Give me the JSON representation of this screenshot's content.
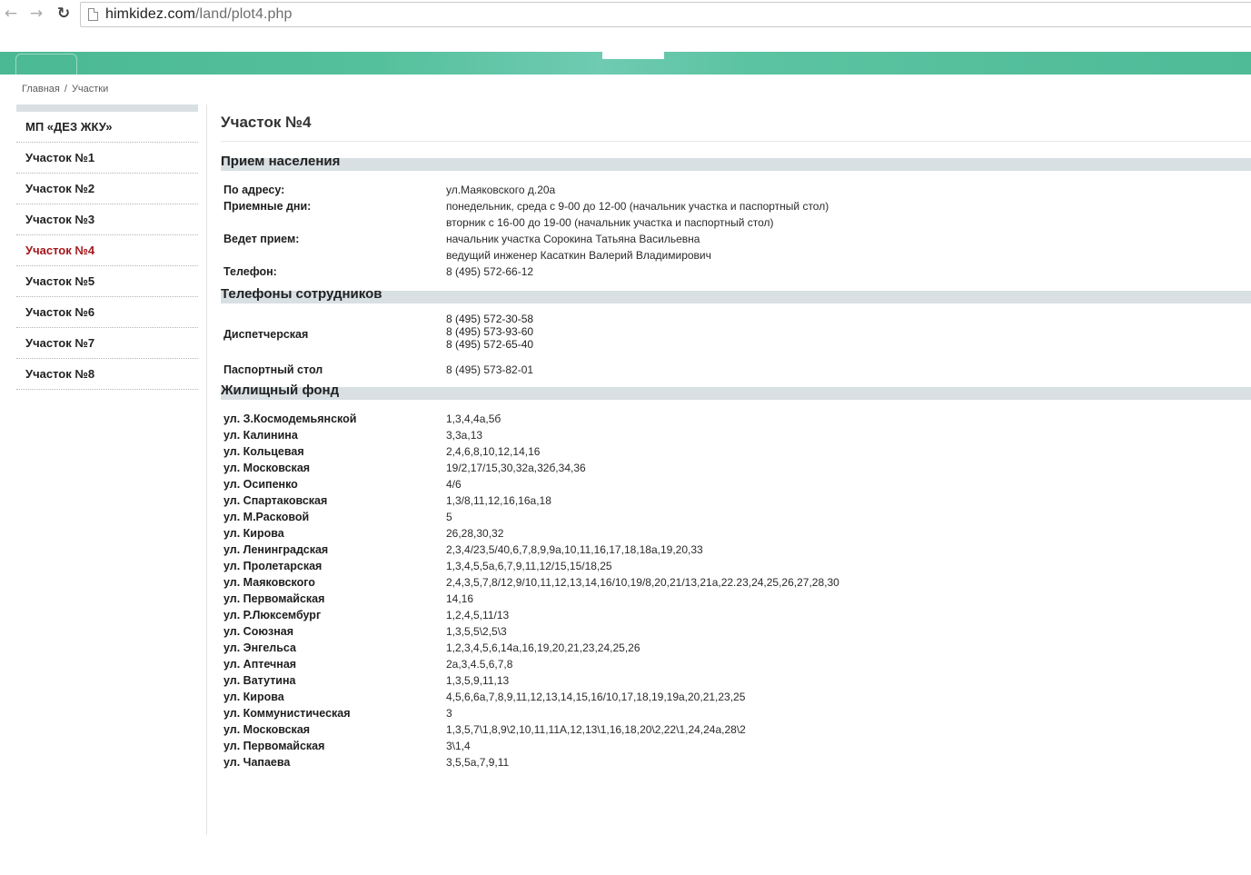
{
  "browser": {
    "url_host": "himkidez.com",
    "url_path": "/land/plot4.php"
  },
  "breadcrumb": {
    "home": "Главная",
    "sep": "/",
    "current": "Участки"
  },
  "sidebar": {
    "items": [
      {
        "label": "МП «ДЕЗ ЖКУ»"
      },
      {
        "label": "Участок №1"
      },
      {
        "label": "Участок №2"
      },
      {
        "label": "Участок №3"
      },
      {
        "label": "Участок №4",
        "active": true
      },
      {
        "label": "Участок №5"
      },
      {
        "label": "Участок №6"
      },
      {
        "label": "Участок №7"
      },
      {
        "label": "Участок №8"
      }
    ],
    "active_color": "#a3171c"
  },
  "main": {
    "title": "Участок №4",
    "reception": {
      "heading": "Прием населения",
      "address_label": "По адресу:",
      "address_value": "ул.Маяковского д.20а",
      "days_label": "Приемные дни:",
      "days_line1": "понедельник, среда с 9-00 до 12-00 (начальник участка и паспортный стол)",
      "days_line2": "вторник с 16-00 до 19-00 (начальник участка и паспортный стол)",
      "host_label": "Ведет прием:",
      "host_line1": "начальник участка Сорокина Татьяна Васильевна",
      "host_line2": "ведущий инженер Касаткин Валерий Владимирович",
      "phone_label": "Телефон:",
      "phone_value": "8 (495) 572-66-12"
    },
    "staff_phones": {
      "heading": "Телефоны сотрудников",
      "dispatch_label": "Диспетчерская",
      "dispatch_phone1": "8 (495) 572-30-58",
      "dispatch_phone2": "8 (495) 573-93-60",
      "dispatch_phone3": "8 (495) 572-65-40",
      "passport_label": "Паспортный стол",
      "passport_phone": "8 (495) 573-82-01"
    },
    "housing": {
      "heading": "Жилищный фонд",
      "rows": [
        {
          "street": "ул. З.Космодемьянской",
          "houses": "1,3,4,4а,5б"
        },
        {
          "street": "ул. Калинина",
          "houses": "3,3а,13"
        },
        {
          "street": "ул. Кольцевая",
          "houses": "2,4,6,8,10,12,14,16"
        },
        {
          "street": "ул. Московская",
          "houses": "19/2,17/15,30,32а,32б,34,36"
        },
        {
          "street": "ул. Осипенко",
          "houses": "4/6"
        },
        {
          "street": "ул. Спартаковская",
          "houses": "1,3/8,11,12,16,16а,18"
        },
        {
          "street": "ул. М.Расковой",
          "houses": "5"
        },
        {
          "street": "ул. Кирова",
          "houses": "26,28,30,32"
        },
        {
          "street": "ул. Ленинградская",
          "houses": "2,3,4/23,5/40,6,7,8,9,9а,10,11,16,17,18,18а,19,20,33"
        },
        {
          "street": "ул. Пролетарская",
          "houses": "1,3,4,5,5а,6,7,9,11,12/15,15/18,25"
        },
        {
          "street": "ул. Маяковского",
          "houses": "2,4,3,5,7,8/12,9/10,11,12,13,14,16/10,19/8,20,21/13,21а,22.23,24,25,26,27,28,30"
        },
        {
          "street": "ул. Первомайская",
          "houses": "14,16"
        },
        {
          "street": "ул. Р.Люксембург",
          "houses": "1,2,4,5,11/13"
        },
        {
          "street": "ул. Союзная",
          "houses": "1,3,5,5\\2,5\\3"
        },
        {
          "street": "ул. Энгельса",
          "houses": "1,2,3,4,5,6,14а,16,19,20,21,23,24,25,26"
        },
        {
          "street": "ул. Аптечная",
          "houses": "2а,3,4.5,6,7,8"
        },
        {
          "street": "ул. Ватутина",
          "houses": "1,3,5,9,11,13"
        },
        {
          "street": "ул. Кирова",
          "houses": "4,5,6,6а,7,8,9,11,12,13,14,15,16/10,17,18,19,19а,20,21,23,25"
        },
        {
          "street": "ул. Коммунистическая",
          "houses": "3"
        },
        {
          "street": "ул. Московская",
          "houses": "1,3,5,7\\1,8,9\\2,10,11,11А,12,13\\1,16,18,20\\2,22\\1,24,24а,28\\2"
        },
        {
          "street": "ул. Первомайская",
          "houses": "3\\1,4"
        },
        {
          "street": "ул. Чапаева",
          "houses": "3,5,5а,7,9,11"
        }
      ]
    }
  },
  "colors": {
    "header_green": "#4bb994",
    "section_band": "#d8e0e4",
    "active_link": "#a3171c"
  }
}
